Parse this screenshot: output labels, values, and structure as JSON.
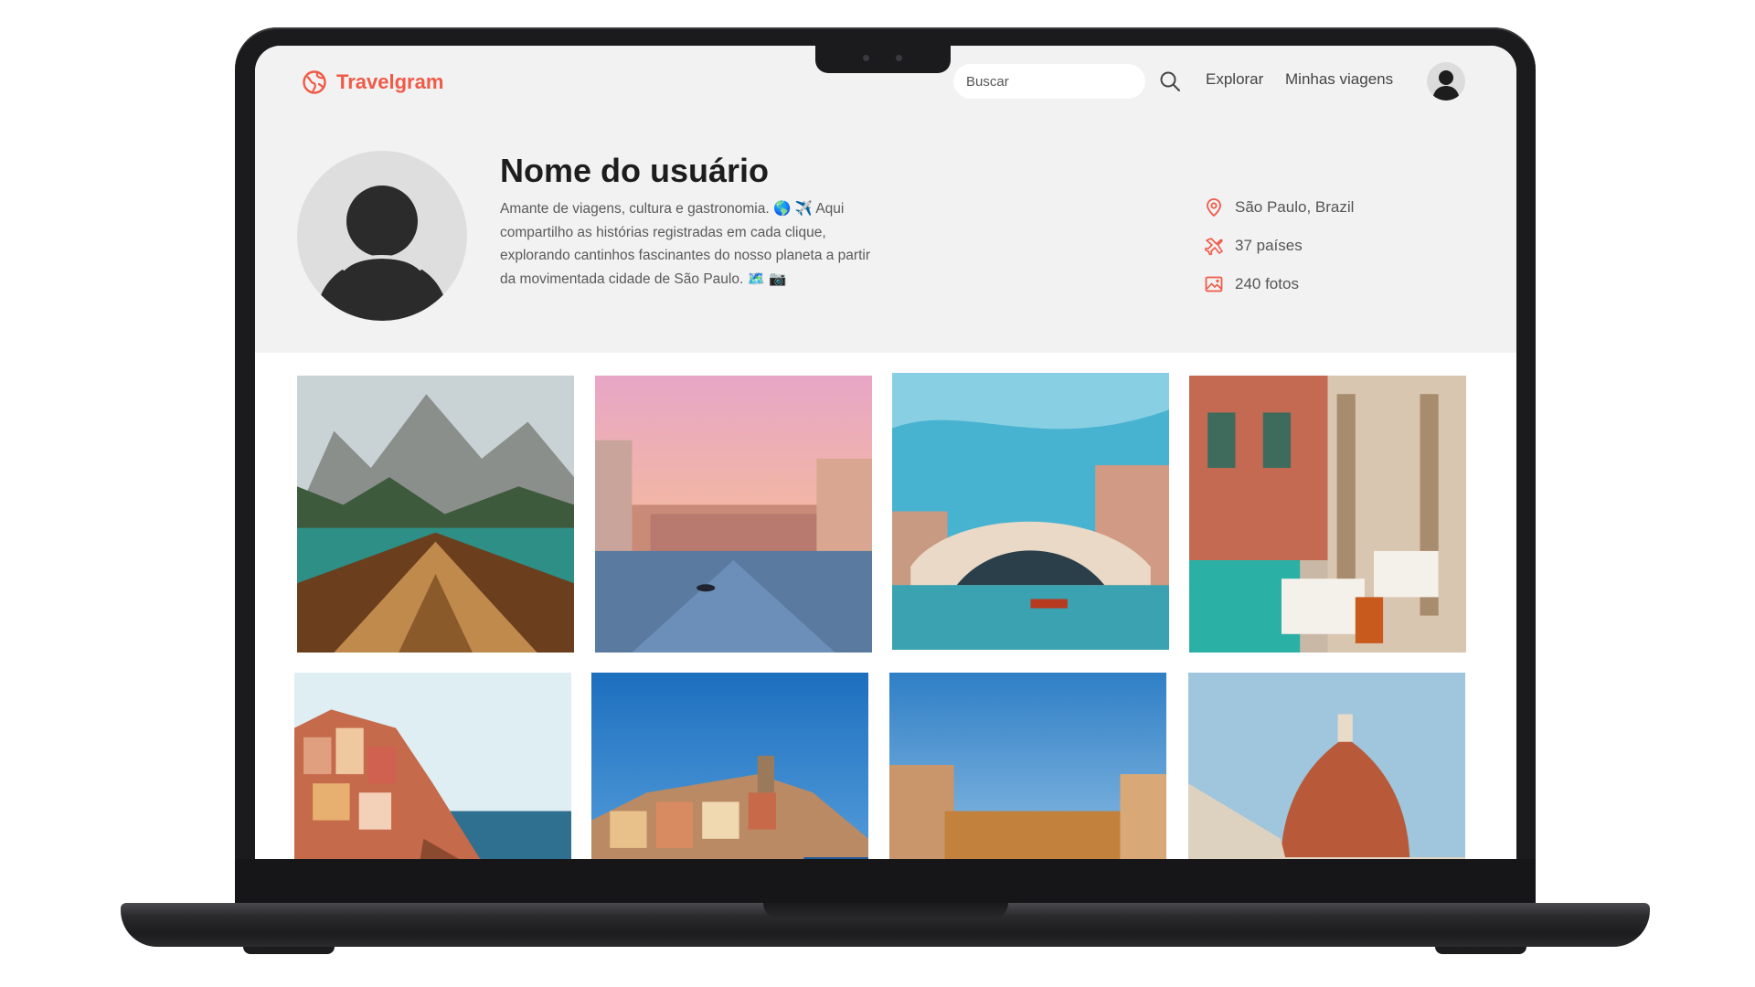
{
  "header": {
    "brand": "Travelgram",
    "search_placeholder": "Buscar",
    "nav": {
      "explore": "Explorar",
      "trips": "Minhas viagens"
    }
  },
  "profile": {
    "name": "Nome do usuário",
    "bio": "Amante de viagens, cultura e gastronomia. 🌎 ✈️ Aqui compartilho as histórias registradas em cada clique, explorando cantinhos fascinantes do nosso planeta a partir da movimentada cidade de São Paulo. 🗺️ 📷",
    "stats": {
      "location": "São Paulo, Brazil",
      "countries": "37 países",
      "photos": "240 fotos"
    }
  },
  "photos": [
    {
      "icon": "lake-boat-photo"
    },
    {
      "icon": "venice-canal-sunset-photo"
    },
    {
      "icon": "rialto-bridge-photo"
    },
    {
      "icon": "venice-restaurant-photo"
    },
    {
      "icon": "manarola-cliffs-photo"
    },
    {
      "icon": "vernazza-coast-photo"
    },
    {
      "icon": "ponte-vecchio-photo"
    },
    {
      "icon": "florence-duomo-photo"
    }
  ],
  "colors": {
    "accent": "#f05a47",
    "header_bg": "#f2f2f2",
    "laptop_frame": "#1b1b1d"
  }
}
